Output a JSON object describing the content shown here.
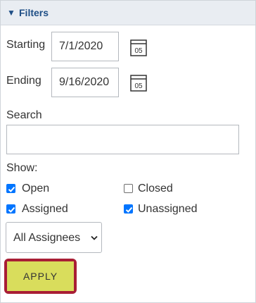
{
  "header": {
    "arrow_glyph": "▼",
    "title": "Filters",
    "color": "#1f4f86"
  },
  "dates": {
    "starting": {
      "label": "Starting",
      "value": "7/1/2020",
      "calendar_icon": "calendar-icon",
      "calendar_day": "05"
    },
    "ending": {
      "label": "Ending",
      "value": "9/16/2020",
      "calendar_icon": "calendar-icon",
      "calendar_day": "05"
    }
  },
  "search": {
    "label": "Search",
    "value": ""
  },
  "show": {
    "label": "Show:",
    "options": {
      "open": {
        "label": "Open",
        "checked": true
      },
      "closed": {
        "label": "Closed",
        "checked": false
      },
      "assigned": {
        "label": "Assigned",
        "checked": true
      },
      "unassigned": {
        "label": "Unassigned",
        "checked": true
      }
    }
  },
  "assignee_select": {
    "selected": "All Assignees",
    "icon": "chevron-down-icon"
  },
  "apply": {
    "label": "APPLY",
    "button_color": "#d9dd5c",
    "outline_color": "#a81e35"
  },
  "accent_color": "#0075ff"
}
